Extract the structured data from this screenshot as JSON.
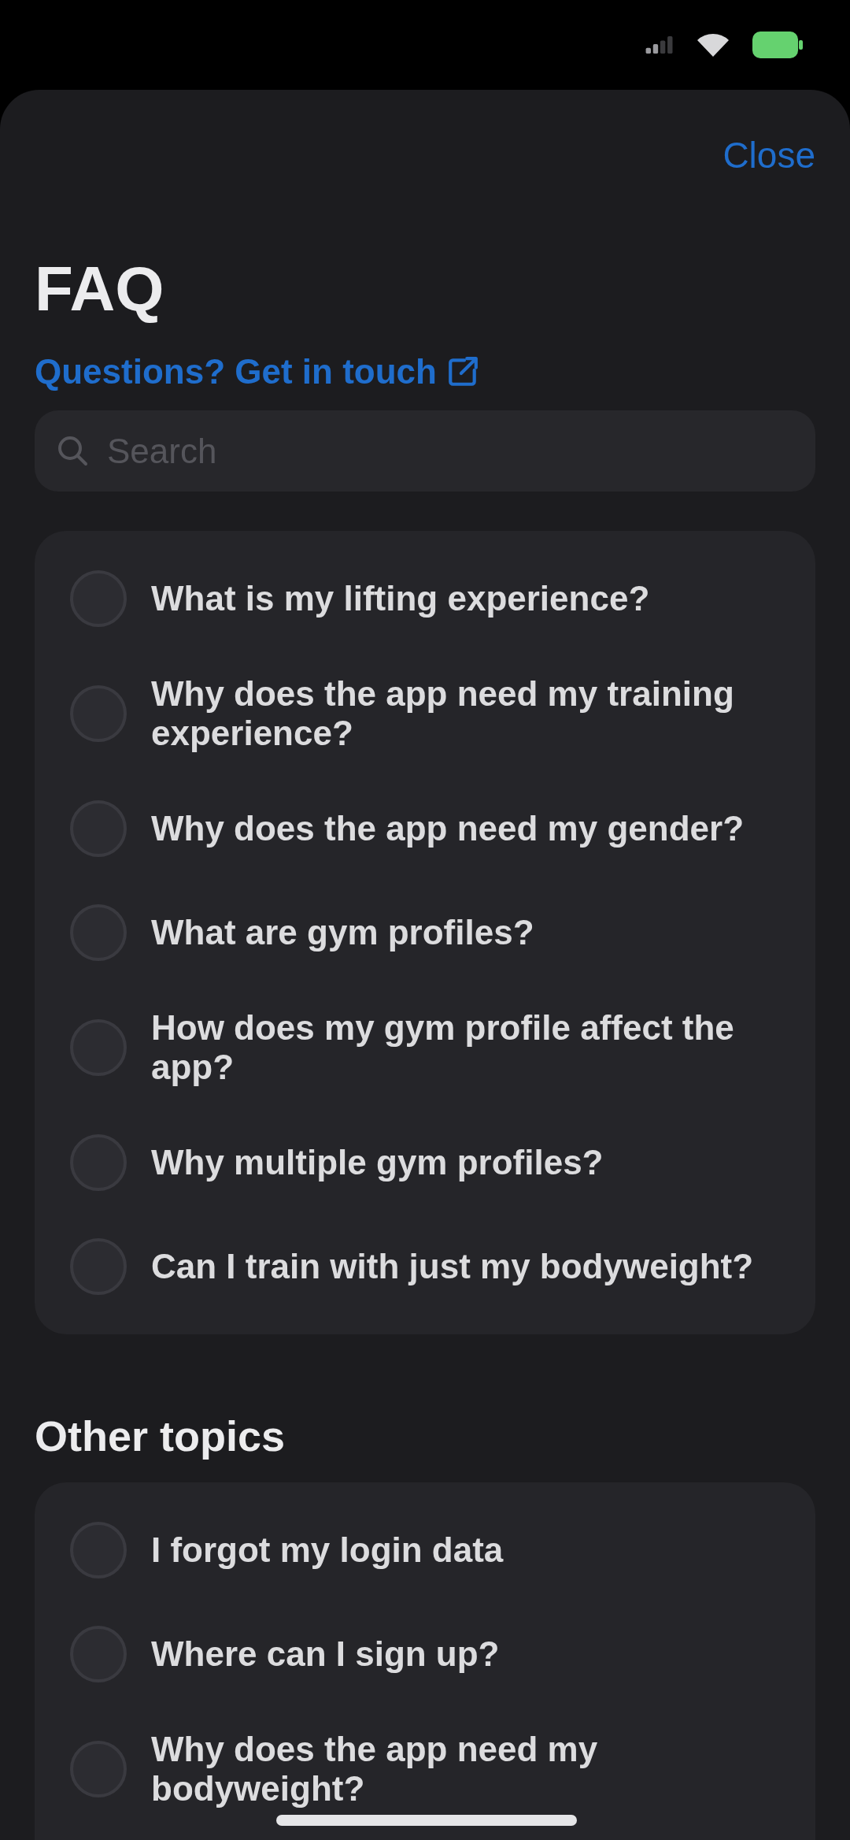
{
  "header": {
    "close": "Close"
  },
  "title": "FAQ",
  "contact_link": "Questions? Get in touch",
  "search": {
    "placeholder": "Search"
  },
  "sections": [
    {
      "items": [
        "What is my lifting experience?",
        "Why does the app need my training experience?",
        "Why does the app need my gender?",
        "What are gym profiles?",
        "How does my gym profile affect the app?",
        "Why multiple gym profiles?",
        "Can I train with just my bodyweight?"
      ]
    },
    {
      "heading": "Other topics",
      "items": [
        "I forgot my login data",
        "Where can I sign up?",
        "Why does the app need my bodyweight?"
      ]
    }
  ]
}
